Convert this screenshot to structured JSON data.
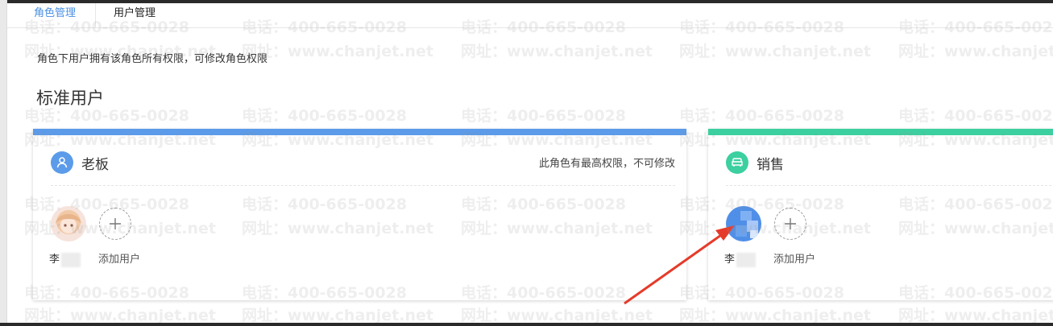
{
  "tabs": [
    {
      "label": "角色管理",
      "active": true
    },
    {
      "label": "用户管理",
      "active": false
    }
  ],
  "description": "角色下用户拥有该角色所有权限，可修改角色权限",
  "section_title": "标准用户",
  "roles": [
    {
      "name": "老板",
      "note": "此角色有最高权限，不可修改",
      "bar_color": "#5b9bea",
      "icon_color": "#5b9bea",
      "icon": "user-icon",
      "user_name": "李",
      "add_label": "添加用户"
    },
    {
      "name": "销售",
      "note": "",
      "bar_color": "#3ccfa0",
      "icon_color": "#3ccfa0",
      "icon": "sofa-icon",
      "user_name": "李",
      "add_label": "添加用户"
    }
  ],
  "watermark": {
    "phone": "电话：400-665-0028",
    "site": "网址：www.chanjet.net"
  },
  "colors": {
    "accent": "#4a90e2",
    "annotation_arrow": "#e53b2a"
  }
}
